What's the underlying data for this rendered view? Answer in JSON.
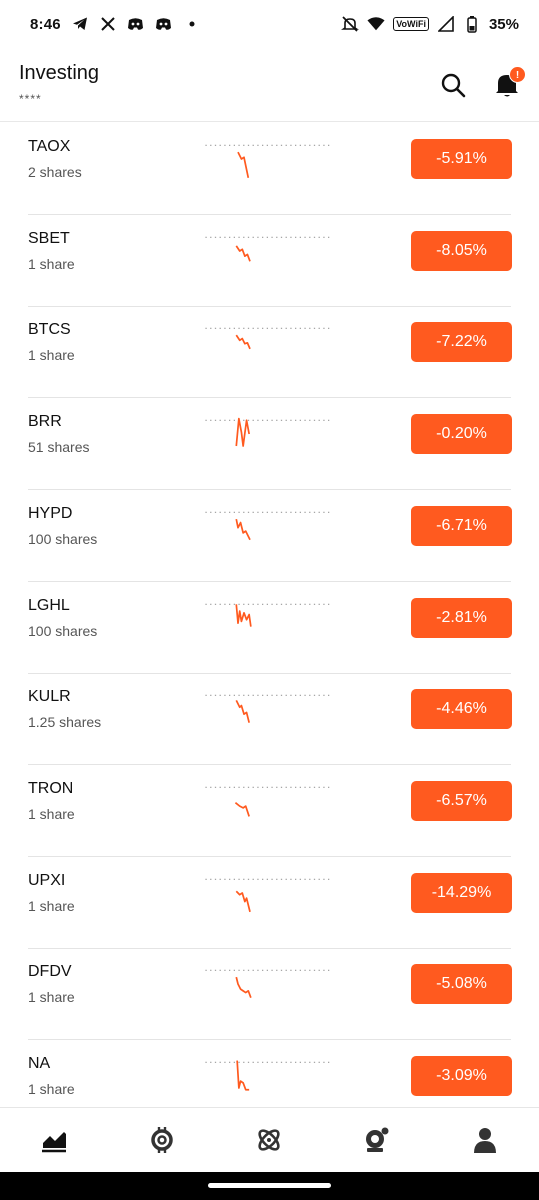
{
  "status_bar": {
    "time": "8:46",
    "left_icons": [
      "telegram-icon",
      "x-icon",
      "discord-icon",
      "discord-icon",
      "dot-icon"
    ],
    "vowifi": "VoWiFi",
    "battery": "35%"
  },
  "header": {
    "title": "Investing",
    "subtitle": "****",
    "notification_badge": "!"
  },
  "accent_color": "#ff5a1f",
  "stocks": [
    {
      "ticker": "TAOX",
      "shares": "2 shares",
      "change": "-5.91%"
    },
    {
      "ticker": "SBET",
      "shares": "1 share",
      "change": "-8.05%"
    },
    {
      "ticker": "BTCS",
      "shares": "1 share",
      "change": "-7.22%"
    },
    {
      "ticker": "BRR",
      "shares": "51 shares",
      "change": "-0.20%"
    },
    {
      "ticker": "HYPD",
      "shares": "100 shares",
      "change": "-6.71%"
    },
    {
      "ticker": "LGHL",
      "shares": "100 shares",
      "change": "-2.81%"
    },
    {
      "ticker": "KULR",
      "shares": "1.25 shares",
      "change": "-4.46%"
    },
    {
      "ticker": "TRON",
      "shares": "1 share",
      "change": "-6.57%"
    },
    {
      "ticker": "UPXI",
      "shares": "1 share",
      "change": "-14.29%"
    },
    {
      "ticker": "DFDV",
      "shares": "1 share",
      "change": "-5.08%"
    },
    {
      "ticker": "NA",
      "shares": "1 share",
      "change": "-3.09%"
    }
  ],
  "bottom_nav": [
    "investing-chart-icon",
    "crypto-coin-icon",
    "atom-icon",
    "retirement-icon",
    "account-icon"
  ]
}
